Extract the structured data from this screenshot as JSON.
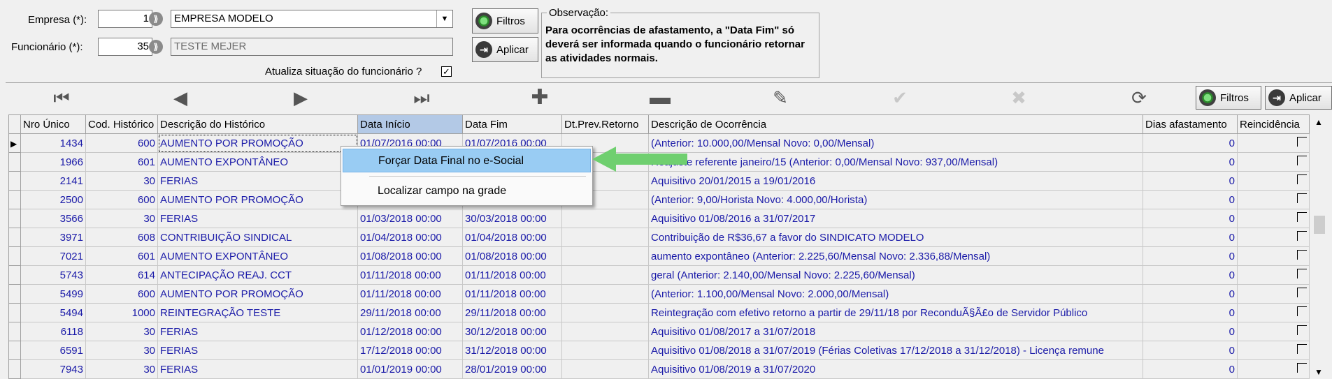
{
  "form": {
    "empresa_label": "Empresa (*):",
    "empresa_code": "1",
    "empresa_name": "EMPRESA MODELO",
    "funcionario_label": "Funcionário (*):",
    "funcionario_code": "35",
    "funcionario_name": "TESTE MEJER",
    "atualiza_label": "Atualiza situação do funcionário ?",
    "atualiza_checked": "✓"
  },
  "buttons": {
    "filtros": "Filtros",
    "aplicar": "Aplicar"
  },
  "observacao": {
    "title": "Observação:",
    "text": "Para ocorrências de afastamento, a \"Data Fim\" só deverá ser informada quando o funcionário retornar as atividades normais."
  },
  "toolbar": {
    "filtros": "Filtros",
    "aplicar": "Aplicar"
  },
  "grid": {
    "headers": [
      "Nro Único",
      "Cod. Histórico",
      "Descrição do Histórico",
      "Data Início",
      "Data Fim",
      "Dt.Prev.Retorno",
      "Descrição de Ocorrência",
      "Dias afastamento",
      "Reincidência"
    ],
    "rows": [
      [
        "1434",
        "600",
        "AUMENTO POR PROMOÇÃO",
        "01/07/2016 00:00",
        "01/07/2016 00:00",
        "",
        " (Anterior: 10.000,00/Mensal Novo: 0,00/Mensal)",
        "0"
      ],
      [
        "1966",
        "601",
        "AUMENTO EXPONTÂNEO",
        "",
        "",
        "",
        "Reajuste referente janeiro/15 (Anterior: 0,00/Mensal Novo: 937,00/Mensal)",
        "0"
      ],
      [
        "2141",
        "30",
        "FERIAS",
        "",
        "",
        "",
        "Aquisitivo 20/01/2015 a 19/01/2016",
        "0"
      ],
      [
        "2500",
        "600",
        "AUMENTO POR PROMOÇÃO",
        "",
        "",
        "",
        " (Anterior: 9,00/Horista Novo: 4.000,00/Horista)",
        "0"
      ],
      [
        "3566",
        "30",
        "FERIAS",
        "01/03/2018 00:00",
        "30/03/2018 00:00",
        "",
        "Aquisitivo 01/08/2016 a 31/07/2017",
        "0"
      ],
      [
        "3971",
        "608",
        "CONTRIBUIÇÃO SINDICAL",
        "01/04/2018 00:00",
        "01/04/2018 00:00",
        "",
        "Contribuição de R$36,67 a favor do SINDICATO MODELO",
        "0"
      ],
      [
        "7021",
        "601",
        "AUMENTO EXPONTÂNEO",
        "01/08/2018 00:00",
        "01/08/2018 00:00",
        "",
        "aumento expontâneo (Anterior: 2.225,60/Mensal Novo: 2.336,88/Mensal)",
        "0"
      ],
      [
        "5743",
        "614",
        "ANTECIPAÇÃO REAJ. CCT",
        "01/11/2018 00:00",
        "01/11/2018 00:00",
        "",
        "geral (Anterior: 2.140,00/Mensal Novo: 2.225,60/Mensal)",
        "0"
      ],
      [
        "5499",
        "600",
        "AUMENTO POR PROMOÇÃO",
        "01/11/2018 00:00",
        "01/11/2018 00:00",
        "",
        " (Anterior: 1.100,00/Mensal Novo: 2.000,00/Mensal)",
        "0"
      ],
      [
        "5494",
        "1000",
        "REINTEGRAÇÃO TESTE",
        "29/11/2018 00:00",
        "29/11/2018 00:00",
        "",
        "Reintegração com efetivo retorno a partir de 29/11/18 por ReconduÃ§Ã£o de Servidor Público",
        "0"
      ],
      [
        "6118",
        "30",
        "FERIAS",
        "01/12/2018 00:00",
        "30/12/2018 00:00",
        "",
        "Aquisitivo 01/08/2017 a 31/07/2018",
        "0"
      ],
      [
        "6591",
        "30",
        "FERIAS",
        "17/12/2018 00:00",
        "31/12/2018 00:00",
        "",
        "Aquisitivo 01/08/2018 a 31/07/2019 (Férias Coletivas 17/12/2018 a 31/12/2018) - Licença remune",
        "0"
      ],
      [
        "7943",
        "30",
        "FERIAS",
        "01/01/2019 00:00",
        "28/01/2019 00:00",
        "",
        "Aquisitivo 01/08/2019 a 31/07/2020",
        "0"
      ]
    ]
  },
  "context_menu": {
    "items": [
      "Forçar Data Final no e-Social",
      "Localizar campo na grade"
    ]
  },
  "colors": {
    "row_text": "#1a1aa8",
    "menu_highlight": "#99ccf3",
    "arrow": "#6fcf6f"
  }
}
